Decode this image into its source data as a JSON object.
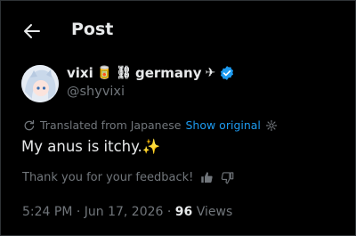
{
  "header": {
    "title": "Post"
  },
  "author": {
    "name": "vixi",
    "name_suffix": "germany",
    "handle": "@shyvixi"
  },
  "post": {
    "translated_label": "Translated from Japanese",
    "show_original": "Show original",
    "text": "My anus is itchy.",
    "text_emoji": "✨",
    "feedback": "Thank you for your feedback!",
    "timestamp": "5:24 PM · Jun 17, 2026 · ",
    "views_count": "96",
    "views_label": " Views"
  },
  "colors": {
    "accent": "#1d9bf0",
    "muted": "#71767b",
    "text": "#e7e9ea"
  },
  "icons": [
    "back-arrow-icon",
    "verified-badge-icon",
    "translate-icon",
    "gear-icon",
    "thumbs-up-icon",
    "thumbs-down-icon"
  ]
}
